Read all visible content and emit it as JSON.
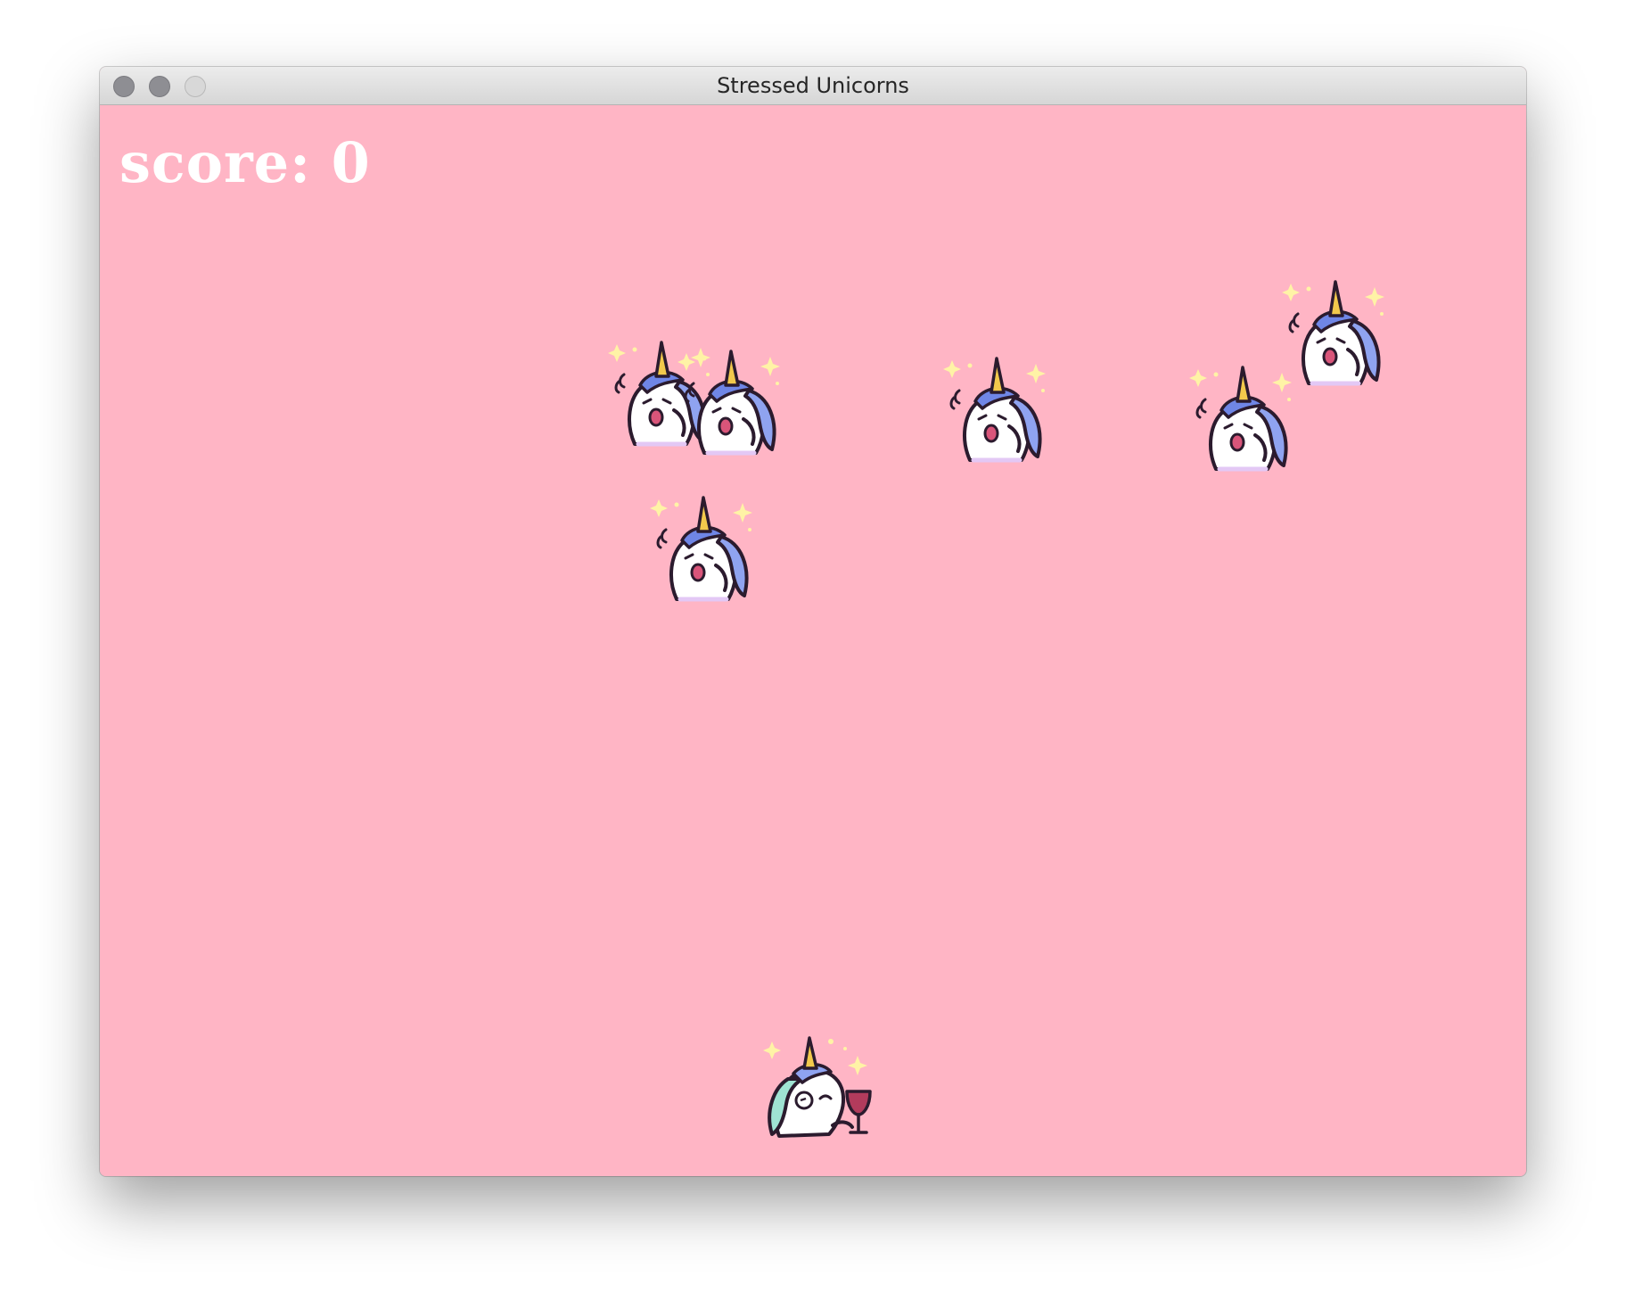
{
  "window": {
    "title": "Stressed Unicorns"
  },
  "hud": {
    "score_text": "score: 0"
  },
  "colors": {
    "background": "#ffb5c5",
    "score_text": "#ffffff",
    "unicorn_mane": "#8fa3f0",
    "unicorn_horn": "#f2c94c",
    "sparkle": "#fff3a6"
  },
  "sprites": {
    "enemy_icon": "stressed-unicorn-icon",
    "player_icon": "relaxed-unicorn-with-wine-icon"
  }
}
